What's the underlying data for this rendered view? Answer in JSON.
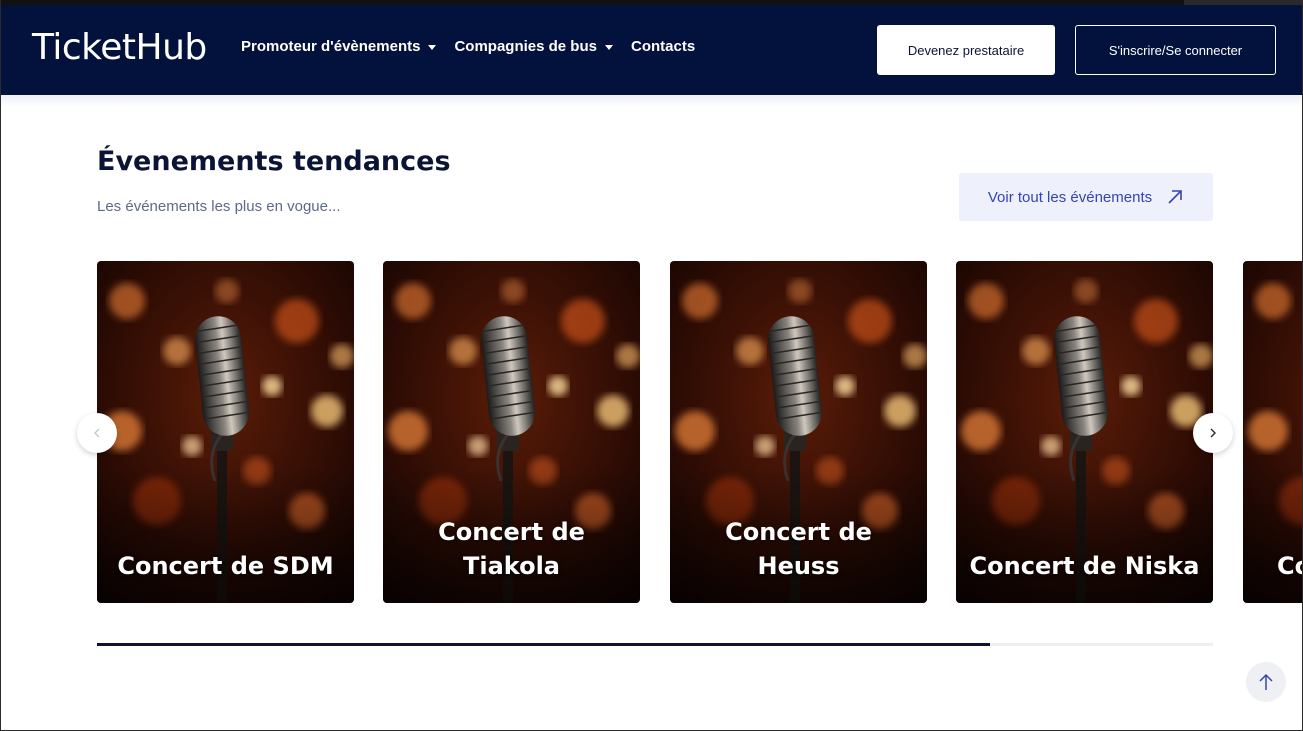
{
  "brand": {
    "name": "TicketHub",
    "primary_color": "#03123d",
    "accent_color": "#3346b0"
  },
  "nav": {
    "items": [
      {
        "label": "Promoteur d'évènements",
        "has_dropdown": true
      },
      {
        "label": "Compagnies de bus",
        "has_dropdown": true
      },
      {
        "label": "Contacts",
        "has_dropdown": false
      }
    ],
    "provider_button": "Devenez prestataire",
    "login_button": "S'inscrire/Se connecter"
  },
  "section": {
    "title": "Évenements tendances",
    "subtitle": "Les événements les plus en vogue...",
    "view_all": "Voir tout les événements",
    "view_all_icon": "arrow-up-right-icon"
  },
  "carousel": {
    "cards": [
      {
        "title": "Concert de SDM"
      },
      {
        "title": "Concert de Tiakola"
      },
      {
        "title": "Concert de Heuss"
      },
      {
        "title": "Concert de Niska"
      },
      {
        "title": "Co"
      }
    ],
    "prev_icon": "chevron-left-icon",
    "next_icon": "chevron-right-icon",
    "progress": 0.8
  },
  "back_to_top_icon": "arrow-up-icon"
}
